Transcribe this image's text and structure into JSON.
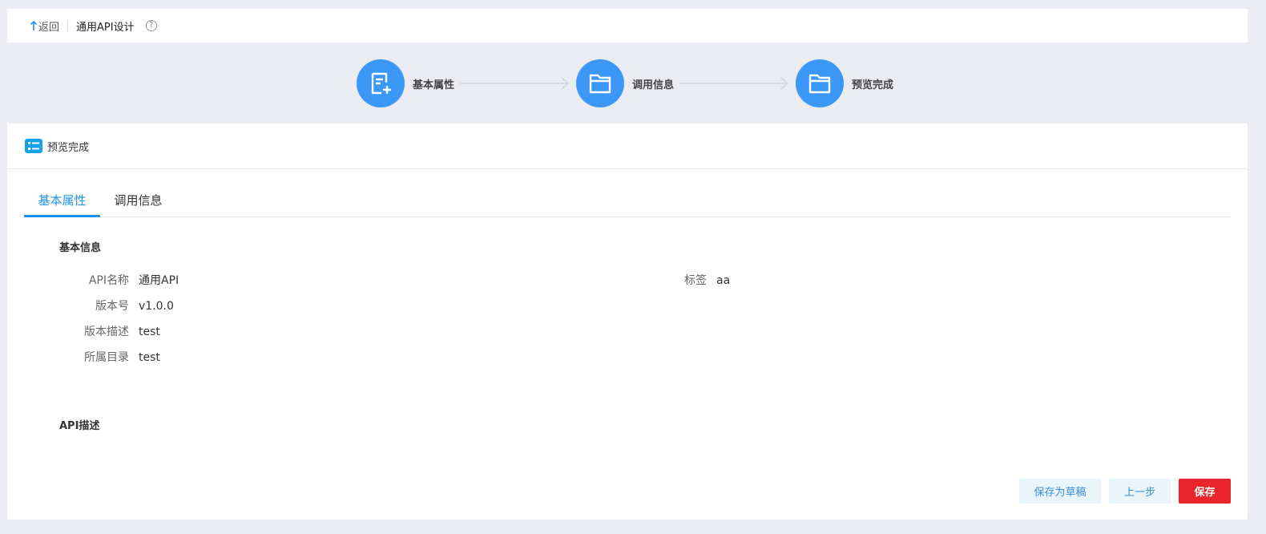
{
  "header": {
    "back_label": "返回",
    "title": "通用API设计",
    "help_glyph": "?"
  },
  "steps": [
    {
      "label": "基本属性",
      "icon": "document-add-icon"
    },
    {
      "label": "调用信息",
      "icon": "folder-icon"
    },
    {
      "label": "预览完成",
      "icon": "folder-icon"
    }
  ],
  "card": {
    "title": "预览完成",
    "tabs": [
      {
        "label": "基本属性",
        "active": true
      },
      {
        "label": "调用信息",
        "active": false
      }
    ],
    "basic_info": {
      "title": "基本信息",
      "fields": [
        {
          "key": "API名称",
          "value": "通用API"
        },
        {
          "key": "版本号",
          "value": "v1.0.0"
        },
        {
          "key": "版本描述",
          "value": "test"
        },
        {
          "key": "所属目录",
          "value": "test"
        }
      ],
      "tag": {
        "key": "标签",
        "value": "aa"
      }
    },
    "api_desc": {
      "title": "API描述"
    }
  },
  "buttons": {
    "save_draft": "保存为草稿",
    "prev": "上一步",
    "save": "保存"
  },
  "colors": {
    "accent": "#3c98f6",
    "tab_active": "#1f91e7",
    "danger": "#e9242a",
    "light_button_bg": "#eaf4fb"
  }
}
